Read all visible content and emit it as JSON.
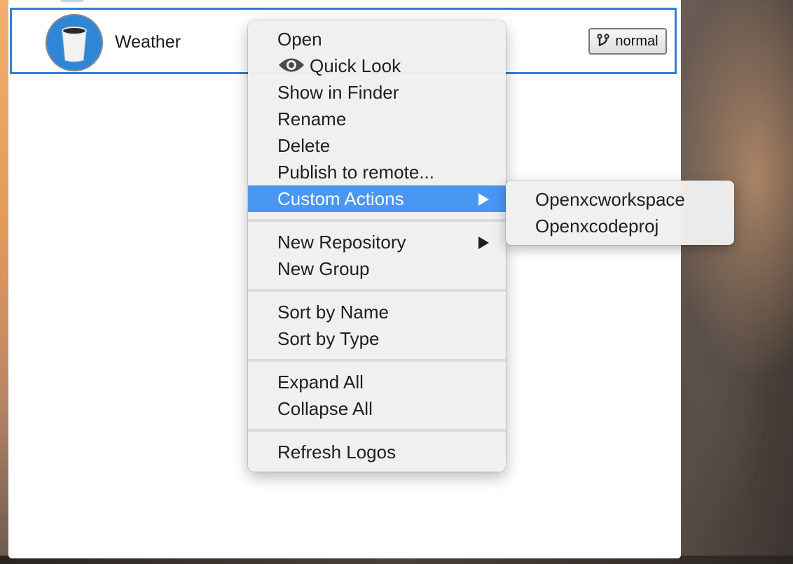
{
  "repository_list": {
    "selected_row": {
      "name": "Weather",
      "branch": "normal"
    }
  },
  "context_menu": {
    "groups": [
      [
        {
          "label": "Open"
        },
        {
          "label": "Quick Look",
          "icon": "eye-icon"
        },
        {
          "label": "Show in Finder"
        },
        {
          "label": "Rename"
        },
        {
          "label": "Delete"
        },
        {
          "label": "Publish to remote..."
        },
        {
          "label": "Custom Actions",
          "has_submenu": true,
          "highlighted": true
        }
      ],
      [
        {
          "label": "New Repository",
          "has_submenu": true
        },
        {
          "label": "New Group"
        }
      ],
      [
        {
          "label": "Sort by Name"
        },
        {
          "label": "Sort by Type"
        }
      ],
      [
        {
          "label": "Expand All"
        },
        {
          "label": "Collapse All"
        }
      ],
      [
        {
          "label": "Refresh Logos"
        }
      ]
    ]
  },
  "custom_actions_submenu": {
    "items": [
      {
        "label": "Openxcworkspace"
      },
      {
        "label": "Openxcodeproj"
      }
    ]
  },
  "colors": {
    "selection_border": "#2f80d6",
    "menu_highlight": "#4a96f3",
    "avatar_blue": "#2e86d4"
  }
}
